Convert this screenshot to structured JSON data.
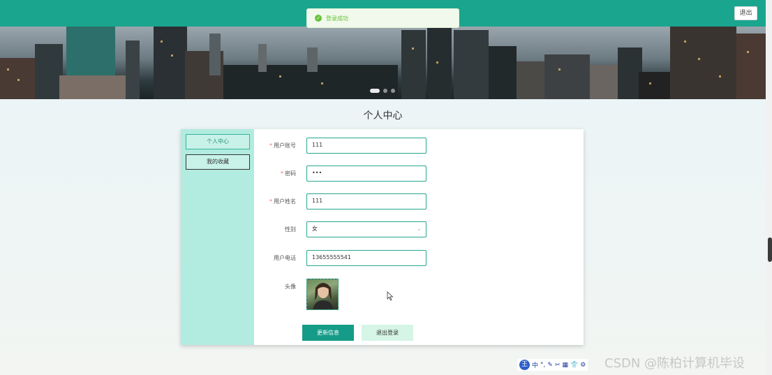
{
  "header": {
    "logout_label": "退出",
    "toast_message": "登录成功",
    "accent_color": "#1aa58e"
  },
  "banner": {
    "slide_count": 3,
    "active_slide": 1
  },
  "page": {
    "title": "个人中心"
  },
  "sidebar": {
    "items": [
      {
        "label": "个人中心",
        "active": true
      },
      {
        "label": "我的收藏",
        "active": false
      }
    ]
  },
  "form": {
    "fields": [
      {
        "label": "用户账号",
        "required": true,
        "value": "111",
        "type": "text"
      },
      {
        "label": "密码",
        "required": true,
        "value": "•••",
        "type": "password"
      },
      {
        "label": "用户姓名",
        "required": true,
        "value": "111",
        "type": "text"
      },
      {
        "label": "性别",
        "required": false,
        "value": "女",
        "type": "select"
      },
      {
        "label": "用户电话",
        "required": false,
        "value": "13655555541",
        "type": "text"
      }
    ],
    "avatar_label": "头像",
    "update_button": "更新信息",
    "logout_button": "退出登录"
  },
  "taskbar": {
    "ime_logo": "王",
    "ime_items": [
      "中",
      "°,",
      "✎",
      "✂",
      "▦",
      "👕",
      "⚙"
    ],
    "watermark": "CSDN @陈柏计算机毕设"
  }
}
